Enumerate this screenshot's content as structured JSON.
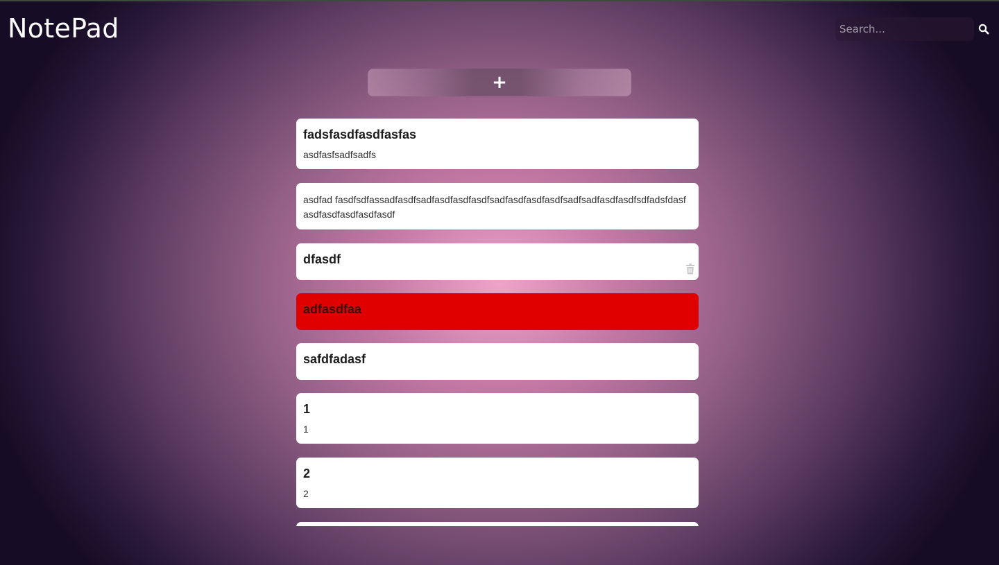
{
  "app": {
    "title": "NotePad"
  },
  "search": {
    "placeholder": "Search...",
    "value": "",
    "icon": "search-icon"
  },
  "add_button": {
    "label": "+"
  },
  "colors": {
    "note_default": "#ffffff",
    "note_highlight": "#e00000"
  },
  "notes": [
    {
      "title": "fadsfasdfasdfasfas",
      "body": "asdfasfsadfsadfs"
    },
    {
      "title": "",
      "body": "asdfad fasdfsdfassadfasdfsadfasdfasdfasdfsadfasdfasdfasdfsadfsadfasdfasdfsdfadsfdasfasdfasdfasdfasdfasdf"
    },
    {
      "title": "dfasdf",
      "body": ""
    },
    {
      "title": "adfasdfaa",
      "body": ""
    },
    {
      "title": "safdfadasf",
      "body": ""
    },
    {
      "title": "1",
      "body": "1"
    },
    {
      "title": "2",
      "body": "2"
    }
  ]
}
